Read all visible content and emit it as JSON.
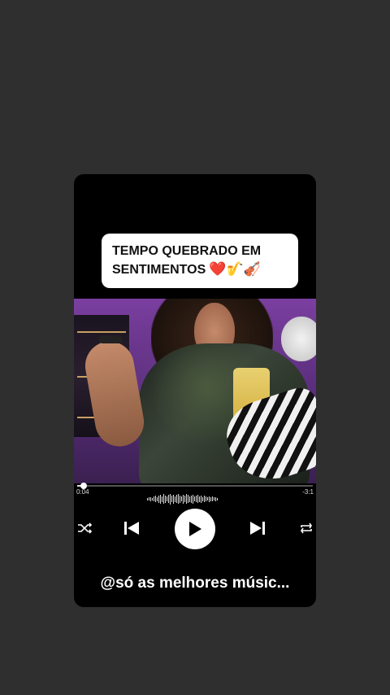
{
  "caption": {
    "line1": "TEMPO QUEBRADO EM",
    "line2": "SENTIMENTOS",
    "emojis": "❤️🎷🎻"
  },
  "player": {
    "current_time": "0:04",
    "remaining_time": "-3:1",
    "progress_fraction": 0.02
  },
  "icons": [
    "shuffle-icon",
    "previous-icon",
    "play-icon",
    "next-icon",
    "repeat-icon"
  ],
  "footer": {
    "handle": "@só as melhores músic..."
  },
  "colors": {
    "background": "#2f2f2f",
    "card": "#000000",
    "accent": "#ffffff"
  }
}
